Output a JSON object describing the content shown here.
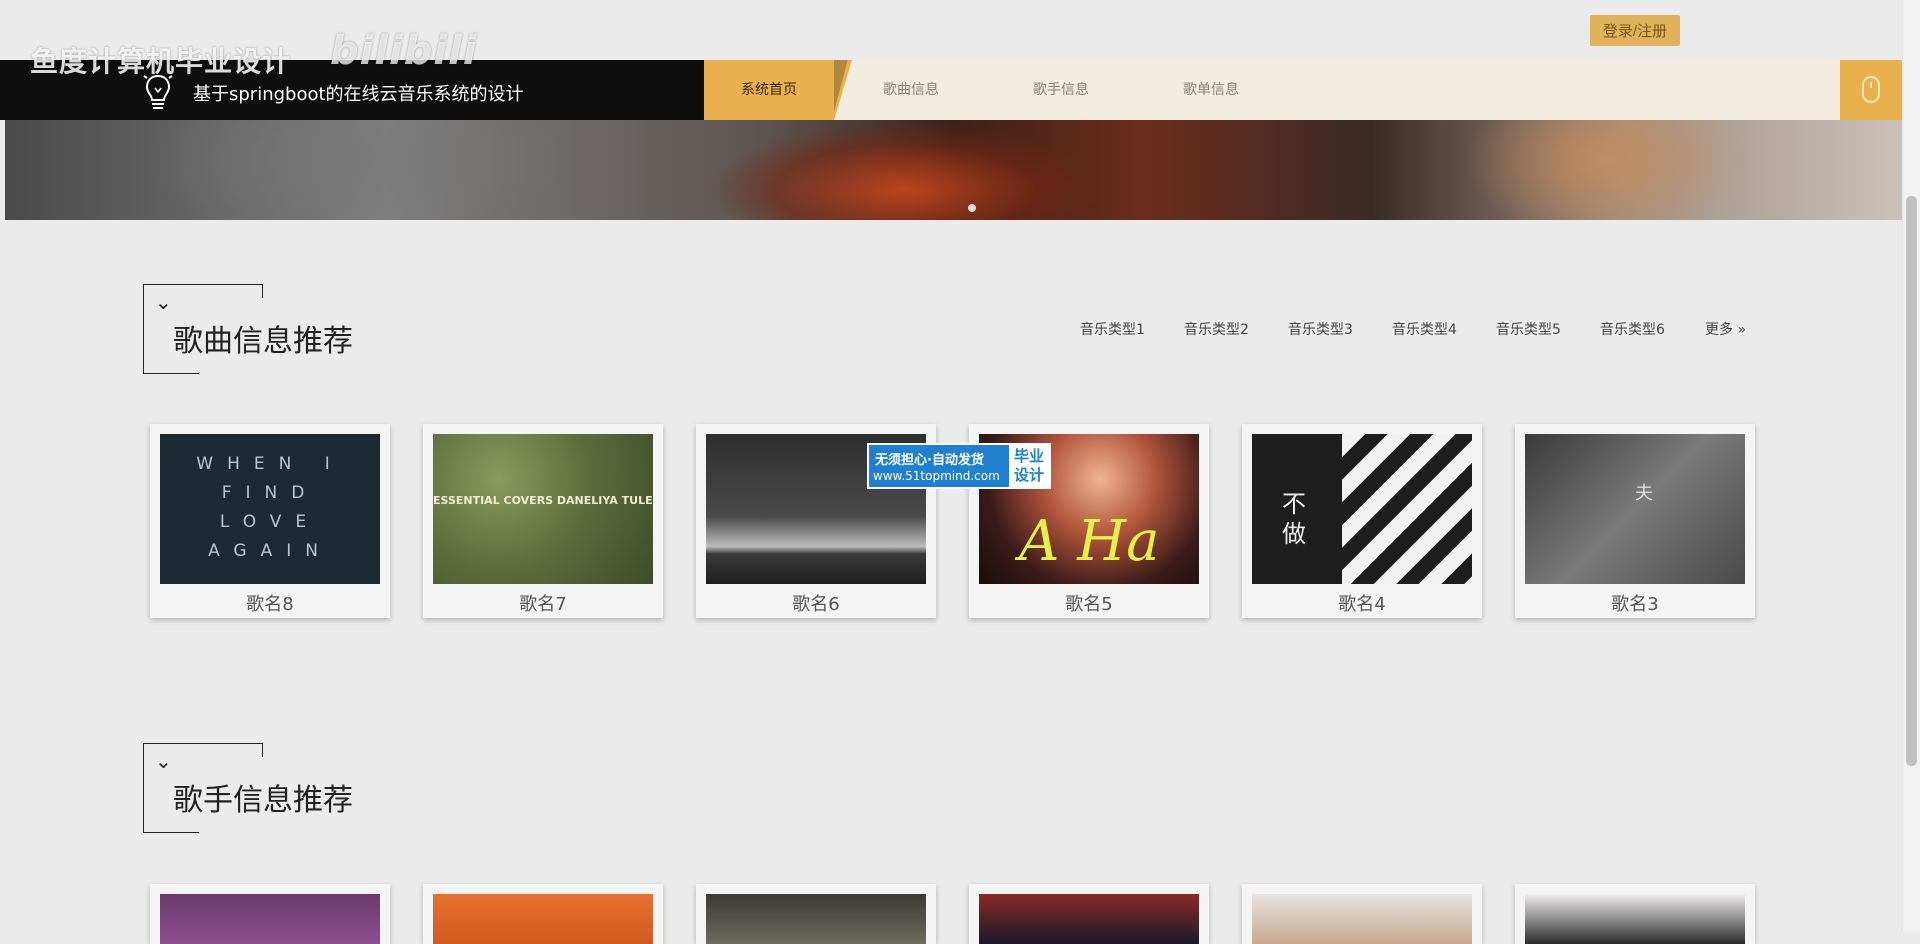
{
  "watermark": {
    "text": "鱼度计算机毕业设计",
    "logo": "bilibili"
  },
  "topbar": {
    "login_label": "登录/注册"
  },
  "navbar": {
    "brand_title": "基于springboot的在线云音乐系统的设计",
    "brand_icon": "lightbulb-icon",
    "items": [
      {
        "label": "系统首页",
        "active": true
      },
      {
        "label": "歌曲信息",
        "active": false
      },
      {
        "label": "歌手信息",
        "active": false
      },
      {
        "label": "歌单信息",
        "active": false
      }
    ],
    "side_icon": "mouse-icon"
  },
  "song_section": {
    "title": "歌曲信息推荐",
    "tabs": [
      "音乐类型1",
      "音乐类型2",
      "音乐类型3",
      "音乐类型4",
      "音乐类型5",
      "音乐类型6"
    ],
    "more_label": "更多 »",
    "cards": [
      {
        "name": "歌名8",
        "cover_text": "WHEN I\nFIND\nLOVE\nAGAIN"
      },
      {
        "name": "歌名7",
        "cover_text": "ESSENTIAL COVERS DANELIYA TULESHOVA"
      },
      {
        "name": "歌名6",
        "cover_text": ""
      },
      {
        "name": "歌名5",
        "cover_text": "A Ha"
      },
      {
        "name": "歌名4",
        "cover_text": "不做"
      },
      {
        "name": "歌名3",
        "cover_text": "夫"
      }
    ]
  },
  "singer_section": {
    "title": "歌手信息推荐"
  },
  "ad": {
    "line1": "无须担心·自动发货",
    "line2": "www.51topmind.com",
    "side": "毕业设计"
  },
  "colors": {
    "accent": "#e8b14e",
    "brand_bg": "#0f0f0f",
    "nav_bg": "#f3ece0",
    "page_bg": "#ebebeb"
  }
}
